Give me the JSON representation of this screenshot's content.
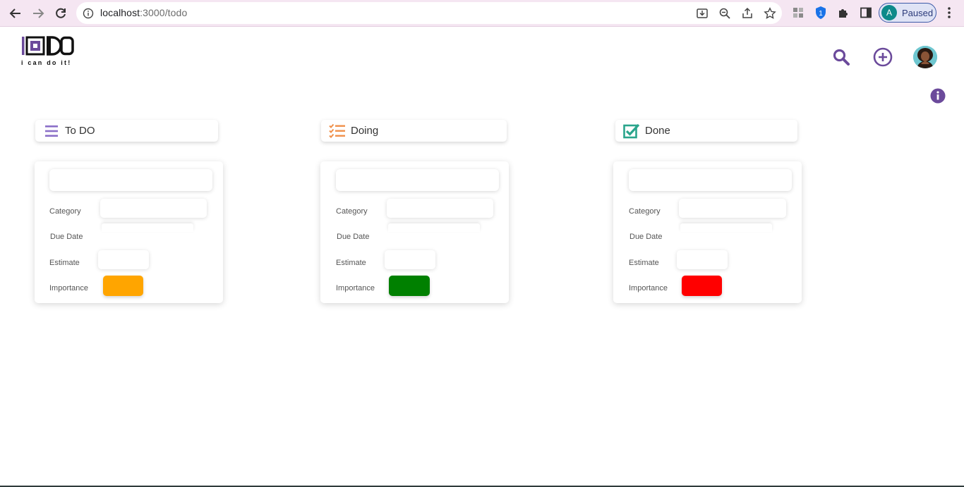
{
  "browser": {
    "url_host": "localhost",
    "url_port_path": ":3000/todo",
    "profile_initial": "A",
    "profile_status": "Paused",
    "extension_badge": "1"
  },
  "app": {
    "logo_text": "IDO",
    "logo_tagline": "i can do it!",
    "brand_color": "#6b4a9b"
  },
  "columns": [
    {
      "title": "To DO",
      "icon": "list-icon",
      "icon_color": "#8b6fc8",
      "card": {
        "category_label": "Category",
        "due_date_label": "Due Date",
        "estimate_label": "Estimate",
        "importance_label": "Importance",
        "importance_color": "#ffa500"
      }
    },
    {
      "title": "Doing",
      "icon": "checklist-icon",
      "icon_color": "#f0904a",
      "card": {
        "category_label": "Category",
        "due_date_label": "Due Date",
        "estimate_label": "Estimate",
        "importance_label": "Importance",
        "importance_color": "#008000"
      }
    },
    {
      "title": "Done",
      "icon": "checked-box-icon",
      "icon_color": "#2aa58c",
      "card": {
        "category_label": "Category",
        "due_date_label": "Due Date",
        "estimate_label": "Estimate",
        "importance_label": "Importance",
        "importance_color": "#ff0000"
      }
    }
  ]
}
